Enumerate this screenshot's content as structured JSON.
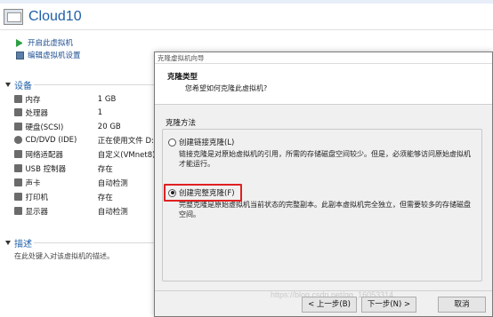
{
  "vm": {
    "title": "Cloud10",
    "actions": [
      {
        "label": "开启此虚拟机",
        "icon": "play-icon"
      },
      {
        "label": "编辑虚拟机设置",
        "icon": "edit-settings-icon"
      }
    ],
    "devices_section": "设备",
    "devices": [
      {
        "name": "内存",
        "value": "1 GB",
        "icon": "memory-icon"
      },
      {
        "name": "处理器",
        "value": "1",
        "icon": "processor-icon"
      },
      {
        "name": "硬盘(SCSI)",
        "value": "20 GB",
        "icon": "hard-disk-icon"
      },
      {
        "name": "CD/DVD (IDE)",
        "value": "正在使用文件 D:…",
        "icon": "cd-dvd-icon"
      },
      {
        "name": "网络适配器",
        "value": "自定义(VMnet8)",
        "icon": "network-adapter-icon"
      },
      {
        "name": "USB 控制器",
        "value": "存在",
        "icon": "usb-icon"
      },
      {
        "name": "声卡",
        "value": "自动检测",
        "icon": "sound-card-icon"
      },
      {
        "name": "打印机",
        "value": "存在",
        "icon": "printer-icon"
      },
      {
        "name": "显示器",
        "value": "自动检测",
        "icon": "display-icon"
      }
    ],
    "description_section": "描述",
    "description_hint": "在此处键入对该虚拟机的描述。"
  },
  "wizard": {
    "window_title": "克隆虚拟机向导",
    "header_title": "克隆类型",
    "header_subtitle": "您希望如何克隆此虚拟机?",
    "method_label": "克隆方法",
    "options": [
      {
        "label": "创建链接克隆(L)",
        "checked": false,
        "description": "链接克隆是对原始虚拟机的引用，所需的存储磁盘空间较少。但是，必须能够访问原始虚拟机才能运行。"
      },
      {
        "label": "创建完整克隆(F)",
        "checked": true,
        "description": "完整克隆是原始虚拟机当前状态的完整副本。此副本虚拟机完全独立，但需要较多的存储磁盘空间。"
      }
    ],
    "buttons": {
      "back": "< 上一步(B)",
      "next": "下一步(N) >",
      "cancel": "取消"
    },
    "watermark": "https://blog.csdn.net/qq_16053314"
  },
  "colors": {
    "accent": "#1f5fa8",
    "highlight": "#e02020"
  }
}
